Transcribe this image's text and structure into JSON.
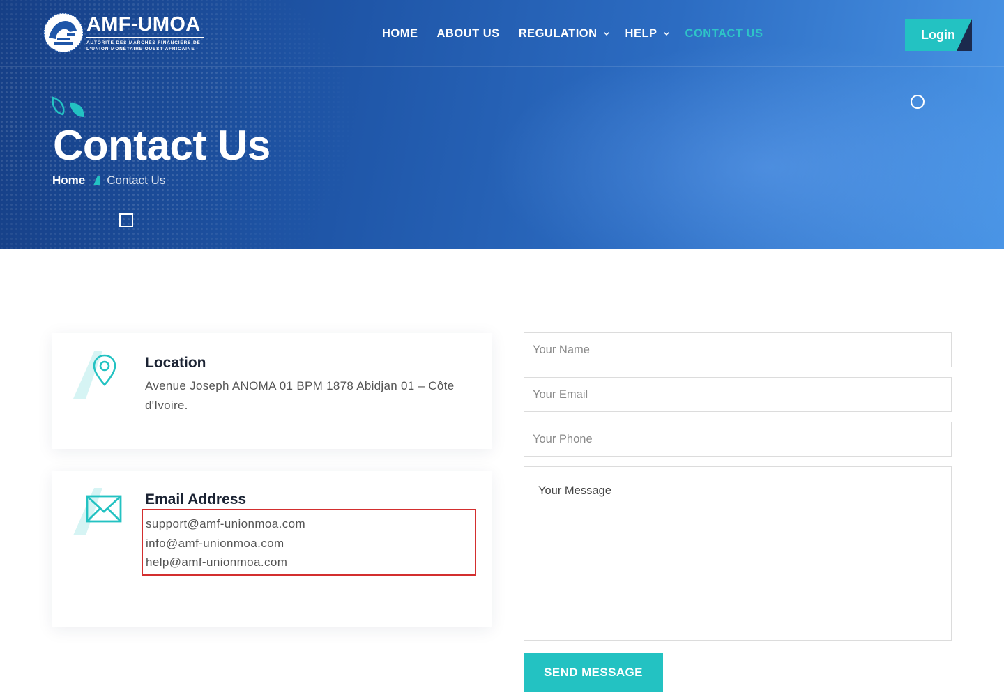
{
  "brand": {
    "title": "AMF-UMOA",
    "subtitle_line1": "AUTORITÉ DES MARCHÉS FINANCIERS DE",
    "subtitle_line2": "L'UNION MONÉTAIRE OUEST AFRICAINE",
    "accent_color": "#23c2c2",
    "dark_color": "#1b2a4d"
  },
  "nav": {
    "items": [
      {
        "label": "HOME",
        "has_dropdown": false,
        "active": false
      },
      {
        "label": "ABOUT US",
        "has_dropdown": false,
        "active": false
      },
      {
        "label": "REGULATION",
        "has_dropdown": true,
        "active": false
      },
      {
        "label": "HELP",
        "has_dropdown": true,
        "active": false
      },
      {
        "label": "CONTACT US",
        "has_dropdown": false,
        "active": true
      }
    ],
    "login_label": "Login"
  },
  "hero": {
    "title": "Contact Us",
    "breadcrumb_home": "Home",
    "breadcrumb_current": "Contact Us"
  },
  "contact": {
    "location_title": "Location",
    "location_text": "Avenue Joseph ANOMA 01 BPM 1878 Abidjan 01 – Côte d'Ivoire.",
    "email_title": "Email Address",
    "emails": [
      "support@amf-unionmoa.com",
      "info@amf-unionmoa.com",
      "help@amf-unionmoa.com"
    ]
  },
  "form": {
    "name_placeholder": "Your Name",
    "email_placeholder": "Your Email",
    "phone_placeholder": "Your Phone",
    "message_placeholder": "Your Message",
    "submit_label": "SEND MESSAGE"
  }
}
